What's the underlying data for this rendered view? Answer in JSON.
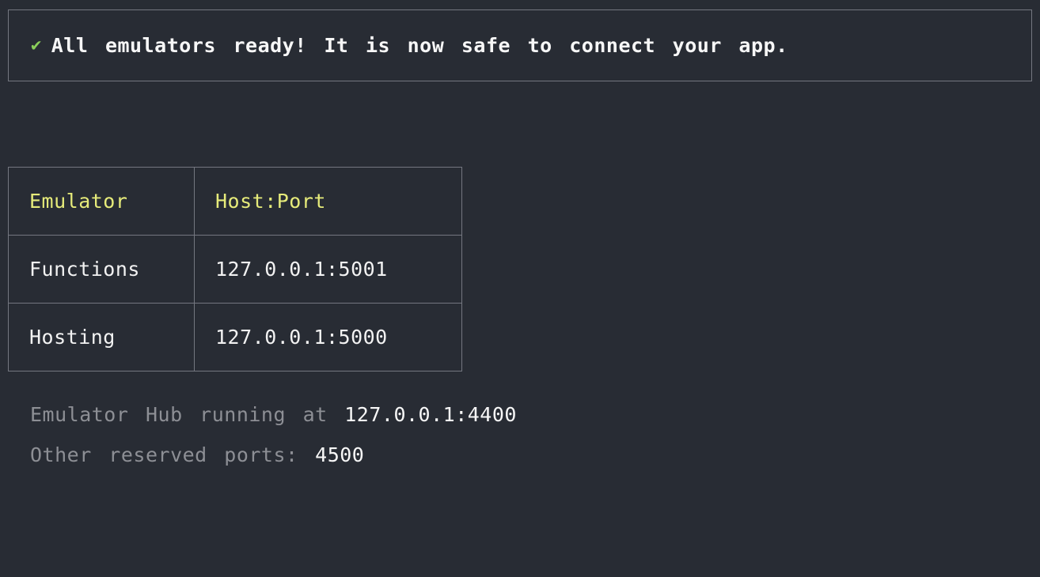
{
  "status": {
    "checkmark": "✔",
    "message": "All emulators ready! It is now safe to connect your app."
  },
  "table": {
    "headers": {
      "emulator": "Emulator",
      "hostport": "Host:Port"
    },
    "rows": [
      {
        "emulator": "Functions",
        "hostport": "127.0.0.1:5001"
      },
      {
        "emulator": "Hosting",
        "hostport": "127.0.0.1:5000"
      }
    ]
  },
  "hub": {
    "label": "Emulator Hub running at ",
    "address": "127.0.0.1:4400"
  },
  "reserved": {
    "label": "Other reserved ports: ",
    "ports": "4500"
  }
}
